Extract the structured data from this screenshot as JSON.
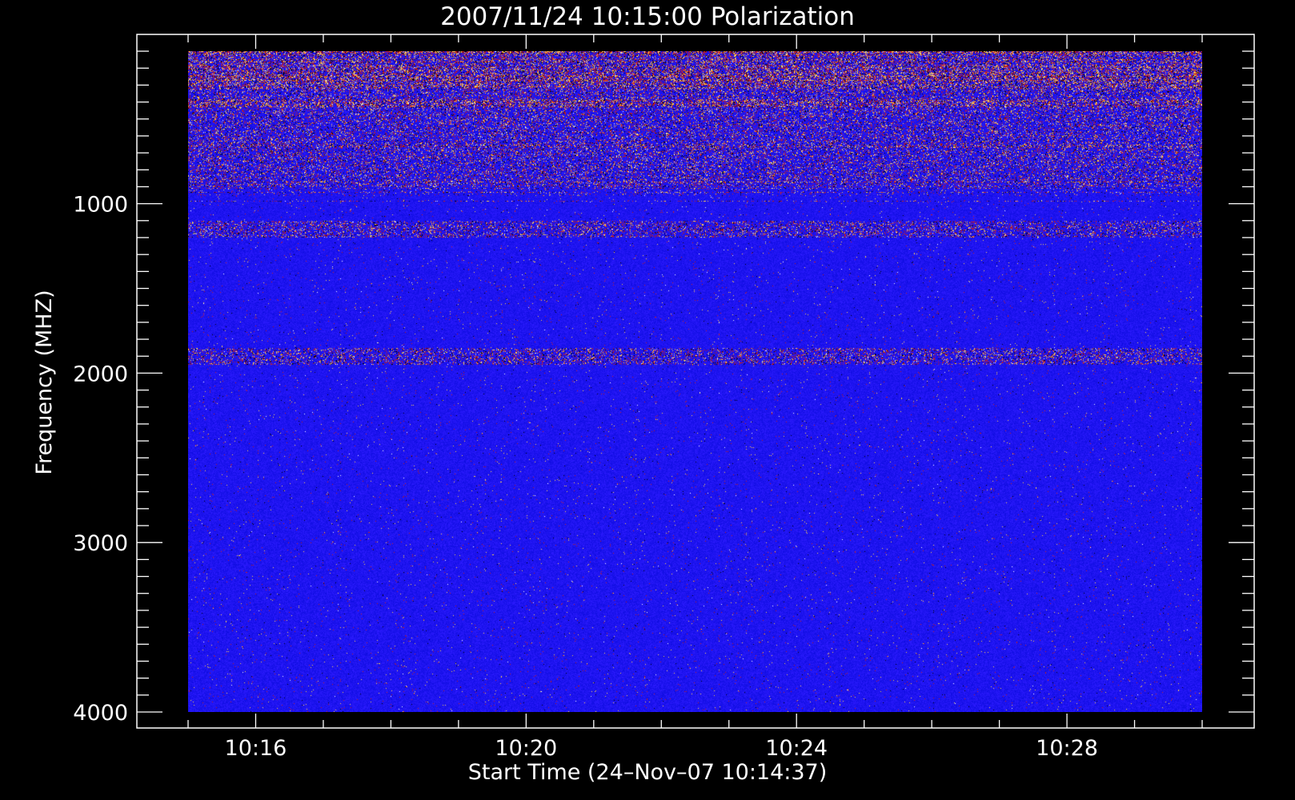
{
  "chart_data": {
    "type": "heatmap",
    "title": "2007/11/24 10:15:00 Polarization",
    "xlabel": "Start Time (24–Nov–07 10:14:37)",
    "ylabel": "Frequency (MHZ)",
    "x_ticks": [
      "10:16",
      "10:20",
      "10:24",
      "10:28"
    ],
    "x_tick_values_min": [
      1,
      5,
      9,
      13
    ],
    "x_range_min": [
      0,
      15
    ],
    "y_ticks": [
      "1000",
      "2000",
      "3000",
      "4000"
    ],
    "y_tick_values": [
      1000,
      2000,
      3000,
      4000
    ],
    "y_range": [
      100,
      4000
    ],
    "y_inverted": true,
    "data_extent": {
      "time_min": [
        0,
        15
      ],
      "frequency": [
        100,
        4000
      ]
    },
    "colors": {
      "background": "#000000",
      "axis": "#ffffff",
      "base": "#1e14f0",
      "low": "#000000",
      "mid": "#c81e1e",
      "high": "#ffd250",
      "max": "#ffffff"
    },
    "features": [
      {
        "band_mhz": [
          100,
          120
        ],
        "intensity": "high"
      },
      {
        "band_mhz": [
          180,
          320
        ],
        "intensity": "high"
      },
      {
        "band_mhz": [
          380,
          430
        ],
        "intensity": "high"
      },
      {
        "band_mhz": [
          430,
          900
        ],
        "intensity": "mid"
      },
      {
        "band_mhz": [
          1100,
          1200
        ],
        "intensity": "mid"
      },
      {
        "band_mhz": [
          1850,
          1950
        ],
        "intensity": "mid"
      }
    ]
  }
}
